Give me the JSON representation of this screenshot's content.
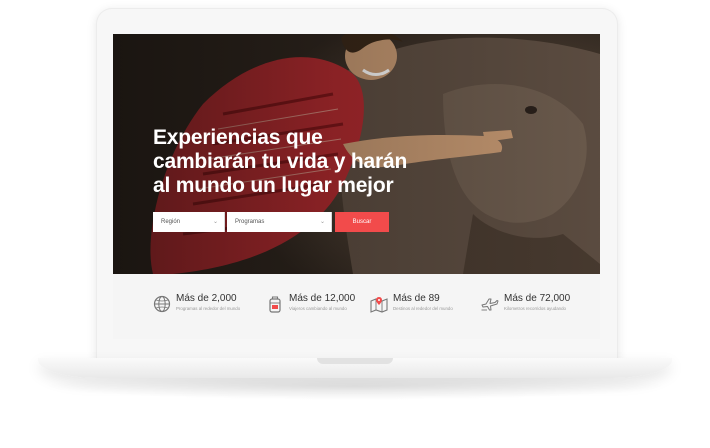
{
  "hero": {
    "headline_lines": [
      "Experiencias que",
      "cambiarán tu vida y harán",
      "al mundo un lugar mejor"
    ]
  },
  "search": {
    "region": "Región",
    "programs": "Programas",
    "button": "Buscar",
    "chevron": "⌄"
  },
  "stats": [
    {
      "icon": "globe-icon",
      "title": "Más de 2,000",
      "subtitle": "Programas al rededor del mundo"
    },
    {
      "icon": "backpack-icon",
      "title": "Más de 12,000",
      "subtitle": "Viajeros cambiando al mundo"
    },
    {
      "icon": "map-pin-icon",
      "title": "Más de 89",
      "subtitle": "Destinos al rededor del mundo"
    },
    {
      "icon": "airplane-icon",
      "title": "Más de 72,000",
      "subtitle": "Kilometros recorridos ayudando"
    }
  ],
  "colors": {
    "accent": "#f24b4b",
    "stats_bg": "#f5f5f5",
    "headline": "#ffffff"
  }
}
